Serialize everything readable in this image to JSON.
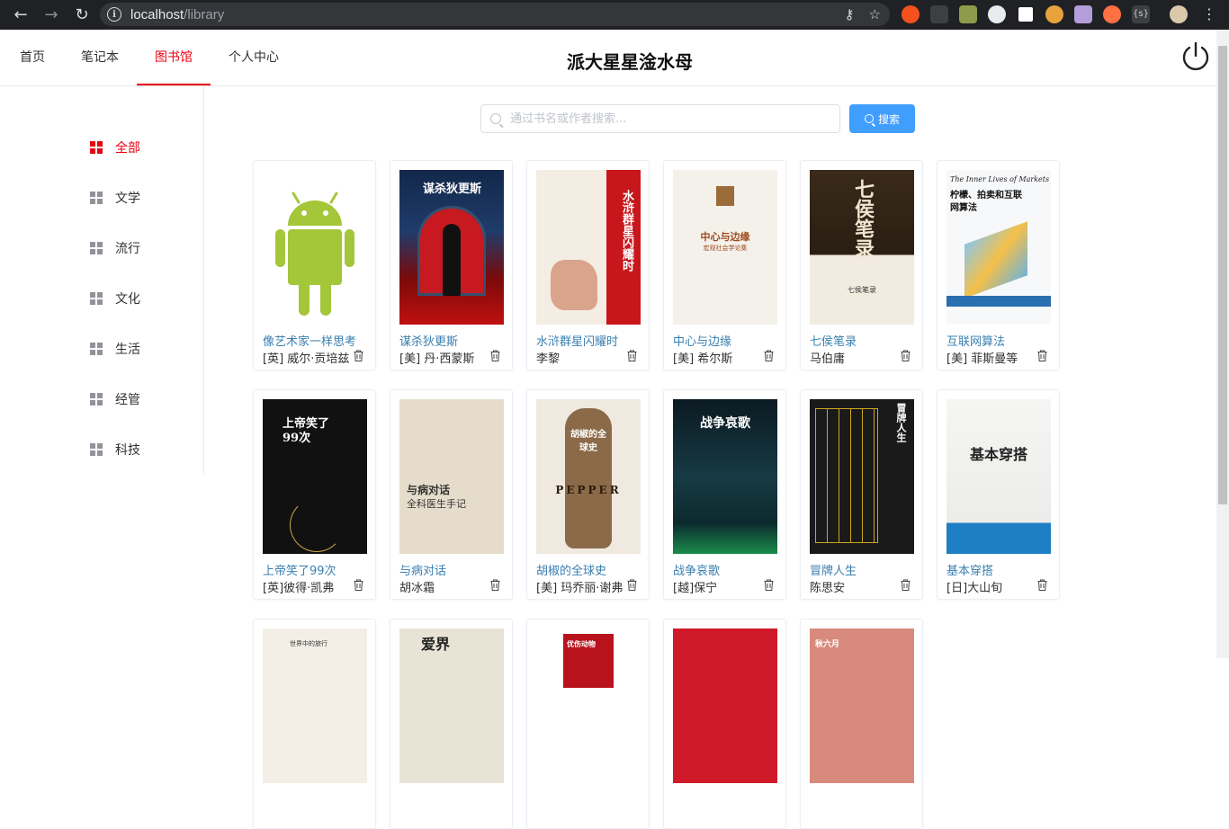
{
  "browser": {
    "url_host": "localhost",
    "url_path": "/library"
  },
  "nav": {
    "tabs": [
      {
        "label": "首页"
      },
      {
        "label": "笔记本"
      },
      {
        "label": "图书馆"
      },
      {
        "label": "个人中心"
      }
    ],
    "site_title": "派大星星淦水母"
  },
  "sidebar": {
    "categories": [
      {
        "label": "全部",
        "active": true
      },
      {
        "label": "文学"
      },
      {
        "label": "流行"
      },
      {
        "label": "文化"
      },
      {
        "label": "生活"
      },
      {
        "label": "经管"
      },
      {
        "label": "科技"
      }
    ]
  },
  "search": {
    "placeholder": "通过书名或作者搜索...",
    "button_label": "搜索"
  },
  "books": [
    {
      "title": "像艺术家一样思考",
      "author": "[英] 威尔·贡培兹",
      "cover": "android"
    },
    {
      "title": "谋杀狄更斯",
      "author": "[美] 丹·西蒙斯",
      "cover_text": "谋杀狄更斯"
    },
    {
      "title": "水浒群星闪耀时",
      "author": "李黎",
      "cover_text": "水浒群星闪耀时"
    },
    {
      "title": "中心与边缘",
      "author": "[美] 希尔斯",
      "cover_text": "中心与边缘",
      "cover_subtext": "宏观社会学论集"
    },
    {
      "title": "七侯笔录",
      "author": "马伯庸",
      "cover_text": "七侯笔录"
    },
    {
      "title": "互联网算法",
      "author": "[美] 菲斯曼等",
      "cover_text": "柠檬、拍卖和互联网算法",
      "cover_subtext": "The Inner Lives of Markets"
    },
    {
      "title": "上帝笑了99次",
      "author": "[英]彼得·凯弗",
      "cover_text": "上帝笑了99次"
    },
    {
      "title": "与病对话",
      "author": "胡冰霜",
      "cover_text": "与病对话",
      "cover_subtext": "全科医生手记"
    },
    {
      "title": "胡椒的全球史",
      "author": "[美] 玛乔丽·谢弗",
      "cover_text": "胡椒的全球史",
      "cover_subtext": "PEPPER"
    },
    {
      "title": "战争哀歌",
      "author": "[越]保宁",
      "cover_text": "战争哀歌"
    },
    {
      "title": "冒牌人生",
      "author": "陈思安",
      "cover_text": "冒牌人生"
    },
    {
      "title": "基本穿搭",
      "author": "[日]大山旬",
      "cover_text": "基本穿搭"
    }
  ],
  "partial_row_cover_text": [
    "世界中的旅行",
    "爱界",
    "优伤动物",
    "",
    "秋六月"
  ],
  "colors": {
    "accent": "#e60012",
    "primary_button": "#409eff",
    "link": "#3a7fb0"
  }
}
